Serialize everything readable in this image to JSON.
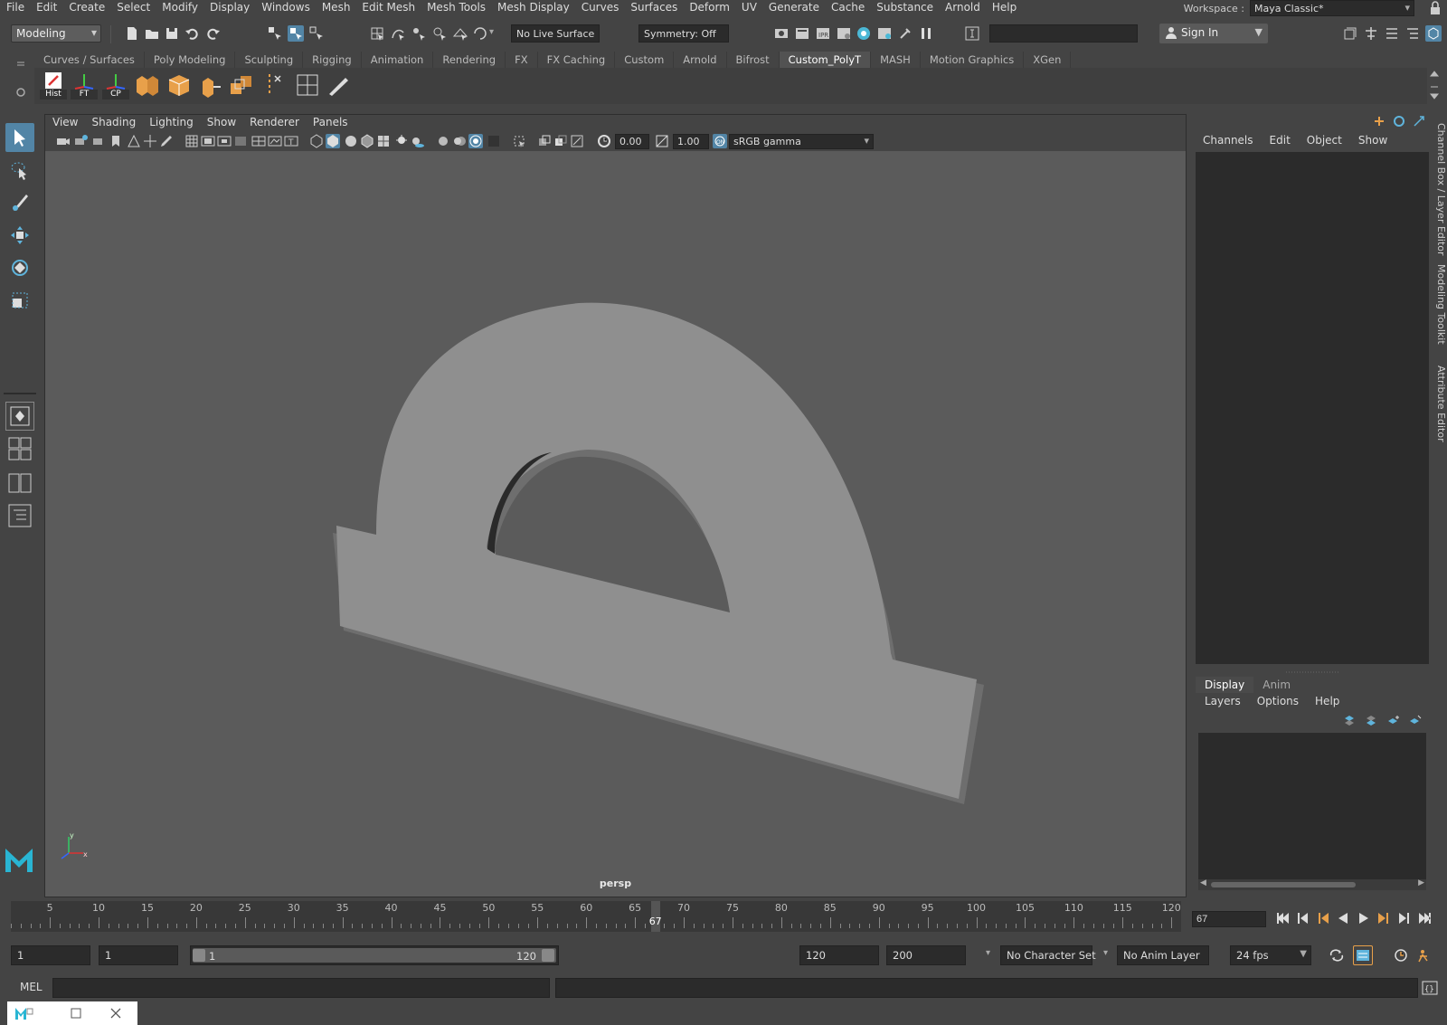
{
  "menubar": {
    "items": [
      "File",
      "Edit",
      "Create",
      "Select",
      "Modify",
      "Display",
      "Windows",
      "Mesh",
      "Edit Mesh",
      "Mesh Tools",
      "Mesh Display",
      "Curves",
      "Surfaces",
      "Deform",
      "UV",
      "Generate",
      "Cache",
      "Substance",
      "Arnold",
      "Help"
    ]
  },
  "workspace": {
    "label": "Workspace :",
    "value": "Maya Classic*"
  },
  "statusline": {
    "menuset": "Modeling",
    "live_surface": "No Live Surface",
    "symmetry": "Symmetry: Off",
    "sign_in": "Sign In"
  },
  "shelf": {
    "tabs": [
      "Curves / Surfaces",
      "Poly Modeling",
      "Sculpting",
      "Rigging",
      "Animation",
      "Rendering",
      "FX",
      "FX Caching",
      "Custom",
      "Arnold",
      "Bifrost",
      "Custom_PolyT",
      "MASH",
      "Motion Graphics",
      "XGen"
    ],
    "active_tab": "Custom_PolyT",
    "buttons": [
      "Hist",
      "FT",
      "CP"
    ]
  },
  "viewport": {
    "menu": [
      "View",
      "Shading",
      "Lighting",
      "Show",
      "Renderer",
      "Panels"
    ],
    "exposure": "0.00",
    "gamma": "1.00",
    "color_space": "sRGB gamma",
    "camera": "persp",
    "background_color": "#5b5b5b",
    "model_color": "#8f8f8f"
  },
  "channel_box": {
    "menu": [
      "Channels",
      "Edit",
      "Object",
      "Show"
    ]
  },
  "layer_editor": {
    "tabs": [
      "Display",
      "Anim"
    ],
    "active_tab": "Display",
    "menu": [
      "Layers",
      "Options",
      "Help"
    ]
  },
  "side_tabs": [
    "Channel Box / Layer Editor",
    "Modeling Toolkit",
    "Attribute Editor"
  ],
  "timeslider": {
    "ticks": [
      "5",
      "10",
      "15",
      "20",
      "25",
      "30",
      "35",
      "40",
      "45",
      "50",
      "55",
      "60",
      "65",
      "70",
      "75",
      "80",
      "85",
      "90",
      "95",
      "100",
      "105",
      "110",
      "115",
      "120"
    ],
    "current_frame": "67",
    "current_frame_field": "67"
  },
  "range": {
    "start_field": "1",
    "playback_start_field": "1",
    "range_start": "1",
    "range_end": "120",
    "playback_end_field": "120",
    "anim_end_field": "200",
    "character_set": "No Character Set",
    "anim_layer": "No Anim Layer",
    "fps": "24 fps"
  },
  "commandline": {
    "label": "MEL"
  },
  "colors": {
    "accent": "#5285a6",
    "panel_dark": "#2b2b2b"
  }
}
